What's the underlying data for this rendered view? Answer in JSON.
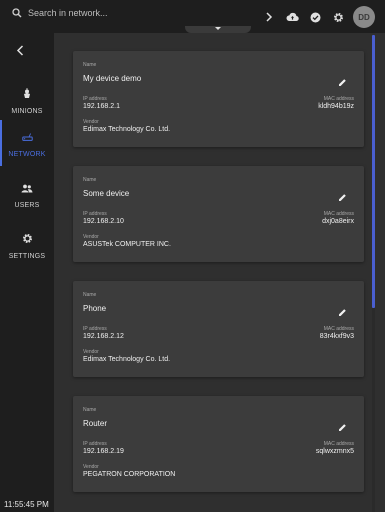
{
  "search": {
    "placeholder": "Search in network..."
  },
  "header": {
    "icons": [
      "chevron-right-icon",
      "cloud-upload-icon",
      "check-circle-icon",
      "gear-icon"
    ],
    "avatar_initials": "DD"
  },
  "sidebar": {
    "items": [
      {
        "label": "MINIONS",
        "icon": "minion-icon",
        "active": false
      },
      {
        "label": "NETWORK",
        "icon": "network-icon",
        "active": true
      },
      {
        "label": "USERS",
        "icon": "users-icon",
        "active": false
      },
      {
        "label": "SETTINGS",
        "icon": "gear-icon",
        "active": false
      }
    ],
    "clock": "11:55:45 PM"
  },
  "fields": {
    "name": "Name",
    "ip": "IP address",
    "mac": "MAC address",
    "vendor": "Vendor"
  },
  "devices": [
    {
      "name": "My device demo",
      "ip": "192.168.2.1",
      "mac": "kldh94b19z",
      "vendor": "Edimax Technology Co. Ltd."
    },
    {
      "name": "Some device",
      "ip": "192.168.2.10",
      "mac": "dxj0a8eirx",
      "vendor": "ASUSTek COMPUTER INC."
    },
    {
      "name": "Phone",
      "ip": "192.168.2.12",
      "mac": "83r4kxf9v3",
      "vendor": "Edimax Technology Co. Ltd."
    },
    {
      "name": "Router",
      "ip": "192.168.2.19",
      "mac": "sqlwxzmnx5",
      "vendor": "PEGATRON CORPORATION"
    }
  ],
  "colors": {
    "accent": "#4a6ee0",
    "background": "#2f2f2f",
    "card": "#3c3c3c",
    "bar": "#1e1e1e"
  }
}
